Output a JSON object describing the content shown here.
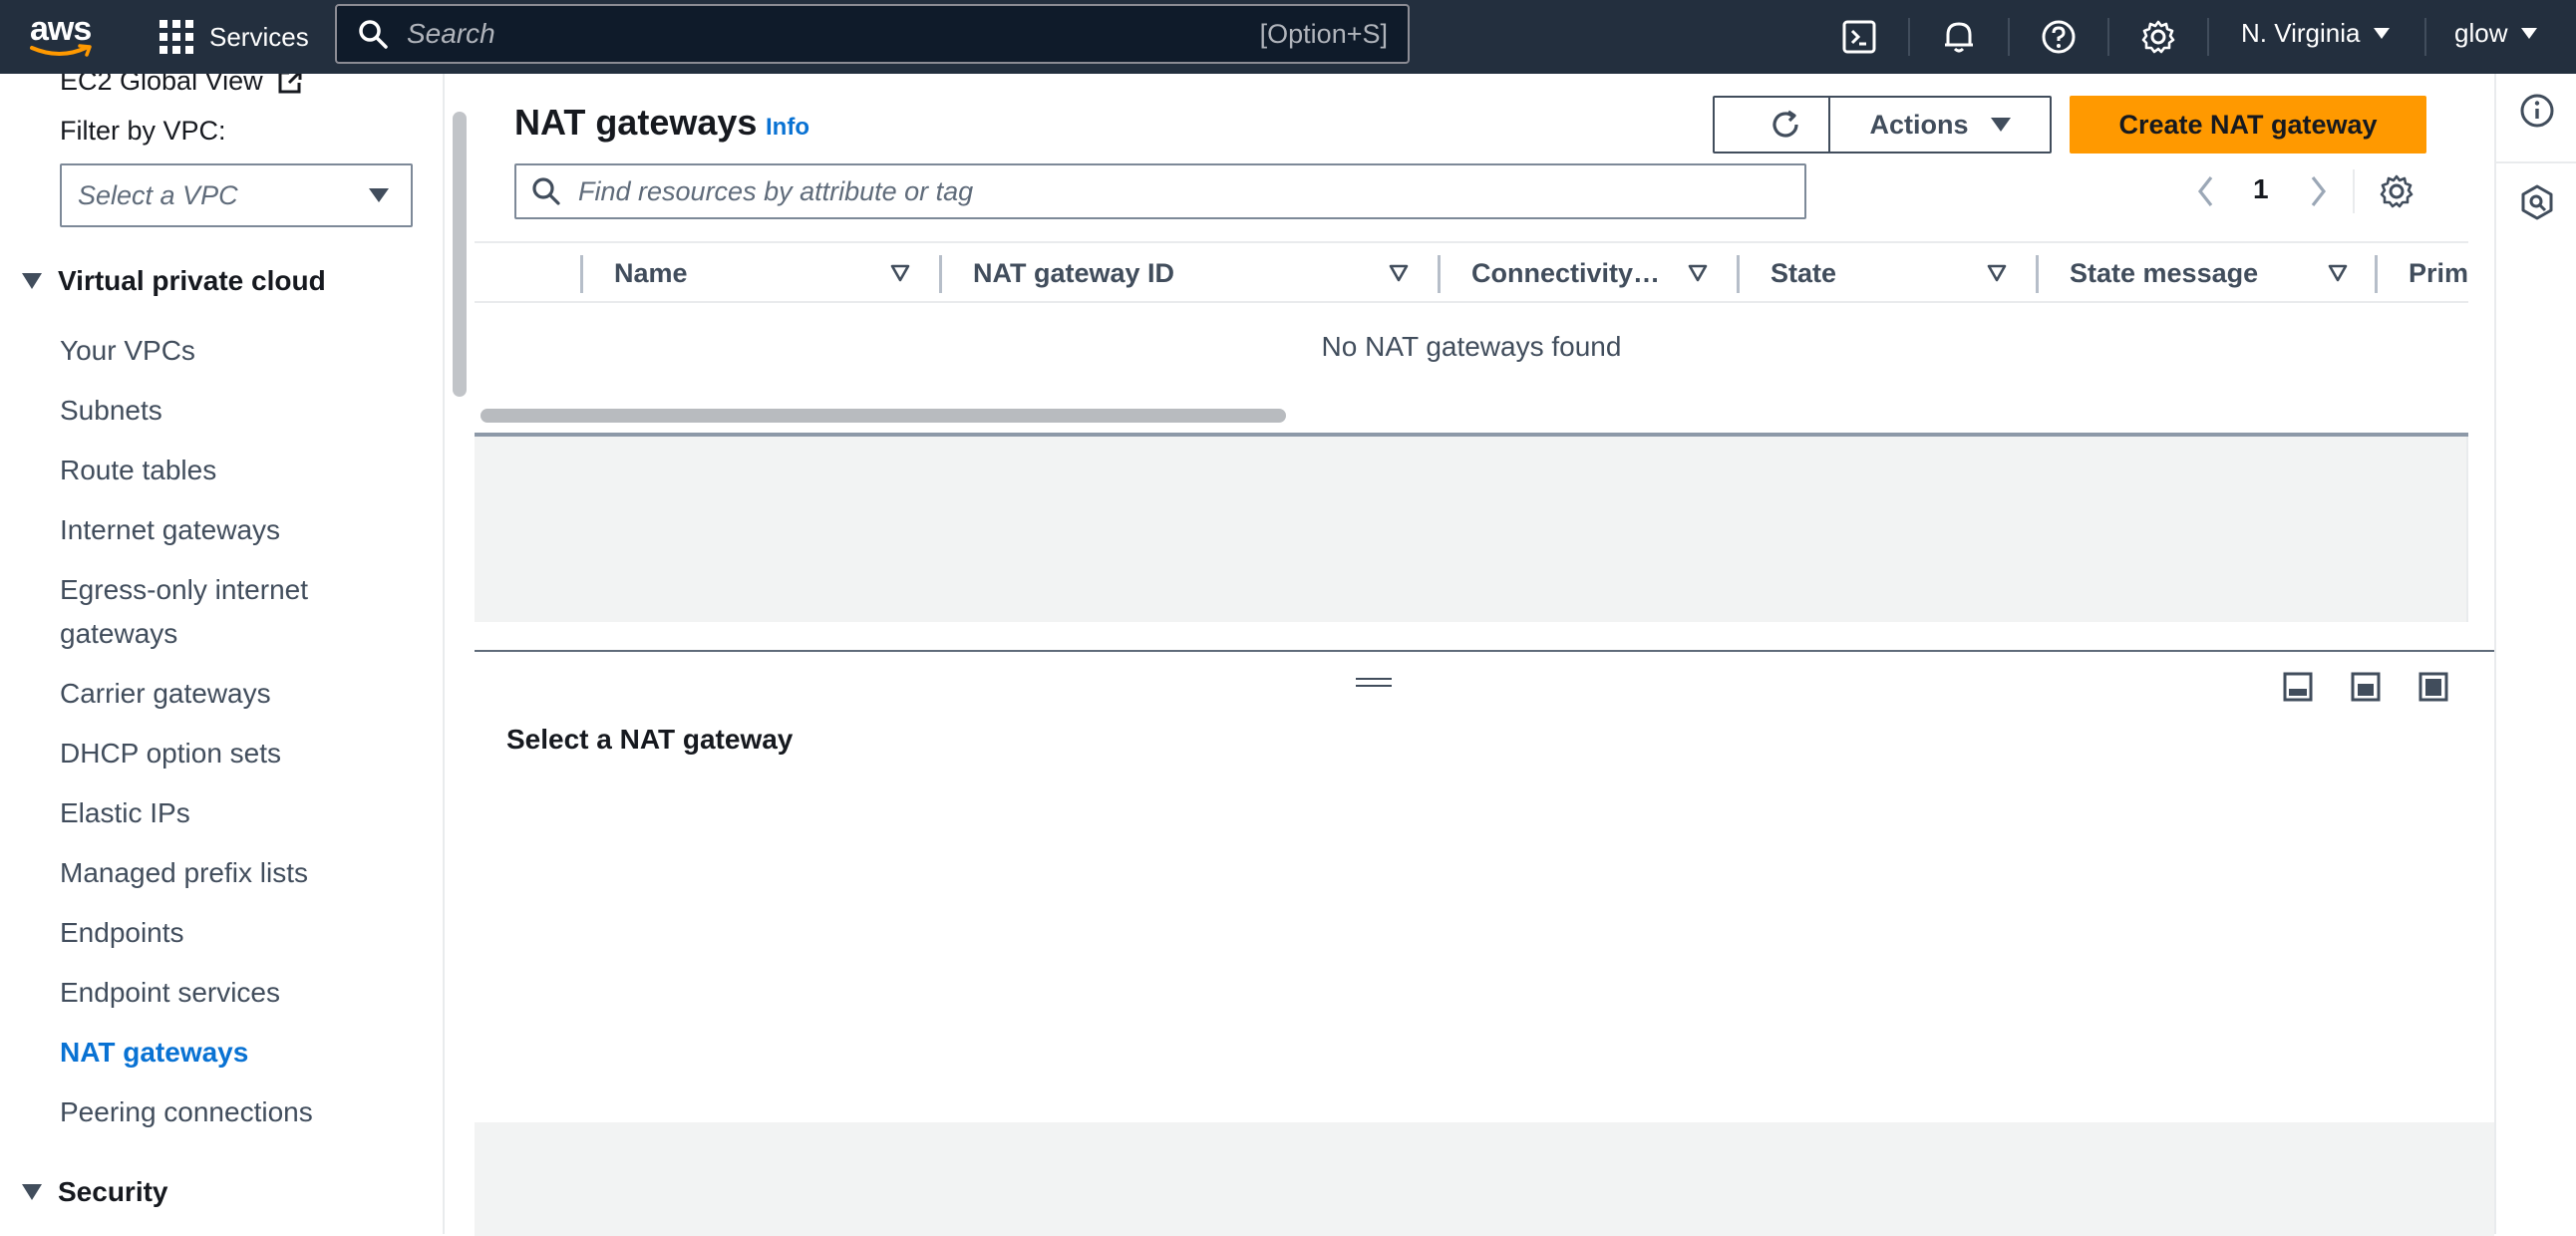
{
  "topnav": {
    "logo_text": "aws",
    "services_label": "Services",
    "search_placeholder": "Search",
    "search_shortcut": "[Option+S]",
    "region": "N. Virginia",
    "account": "glow",
    "icons": [
      "cloudshell-icon",
      "bell-icon",
      "help-icon",
      "settings-icon"
    ]
  },
  "sidebar": {
    "top_link": "EC2 Global View",
    "filter_label": "Filter by VPC:",
    "vpc_select_placeholder": "Select a VPC",
    "section_vpc": "Virtual private cloud",
    "items": [
      {
        "label": "Your VPCs"
      },
      {
        "label": "Subnets"
      },
      {
        "label": "Route tables"
      },
      {
        "label": "Internet gateways"
      },
      {
        "label": "Egress-only internet gateways"
      },
      {
        "label": "Carrier gateways"
      },
      {
        "label": "DHCP option sets"
      },
      {
        "label": "Elastic IPs"
      },
      {
        "label": "Managed prefix lists"
      },
      {
        "label": "Endpoints"
      },
      {
        "label": "Endpoint services"
      },
      {
        "label": "NAT gateways",
        "active": true
      },
      {
        "label": "Peering connections"
      }
    ],
    "section_security": "Security"
  },
  "main": {
    "title": "NAT gateways",
    "info_label": "Info",
    "actions_label": "Actions",
    "create_label": "Create NAT gateway",
    "filter_placeholder": "Find resources by attribute or tag",
    "page_number": "1",
    "columns": [
      "Name",
      "NAT gateway ID",
      "Connectivity…",
      "State",
      "State message",
      "Prim"
    ],
    "empty_message": "No NAT gateways found"
  },
  "split_panel": {
    "title": "Select a NAT gateway"
  },
  "colors": {
    "nav_bg": "#232f3e",
    "accent_link": "#0972d3",
    "primary_button": "#ff9900"
  }
}
